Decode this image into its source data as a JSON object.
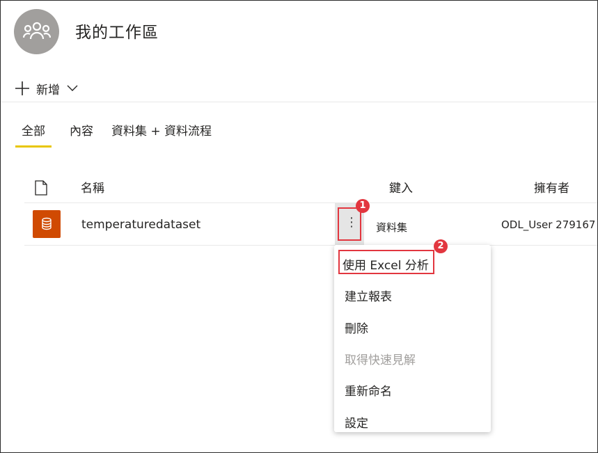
{
  "workspace": {
    "title": "我的工作區",
    "avatar_icon": "people-group-icon"
  },
  "toolbar": {
    "new_label": "新增"
  },
  "tabs": [
    {
      "label": "全部",
      "active": true
    },
    {
      "label": "內容",
      "active": false
    },
    {
      "label": "資料集 + 資料流程",
      "active": false
    }
  ],
  "list": {
    "headers": {
      "name": "名稱",
      "type": "鍵入",
      "owner": "擁有者"
    },
    "rows": [
      {
        "name": "temperaturedataset",
        "type": "資料集",
        "owner": "ODL_User 279167",
        "icon": "dataset-icon"
      }
    ]
  },
  "context_menu": {
    "items": [
      {
        "label": "使用 Excel 分析",
        "enabled": true
      },
      {
        "label": "建立報表",
        "enabled": true
      },
      {
        "label": "刪除",
        "enabled": true
      },
      {
        "label": "取得快速見解",
        "enabled": false
      },
      {
        "label": "重新命名",
        "enabled": true
      },
      {
        "label": "設定",
        "enabled": true
      }
    ]
  },
  "callouts": {
    "step1": "1",
    "step2": "2"
  },
  "colors": {
    "accent_tab": "#e8c600",
    "dataset_icon_bg": "#d04a02",
    "callout": "#e2363f"
  }
}
